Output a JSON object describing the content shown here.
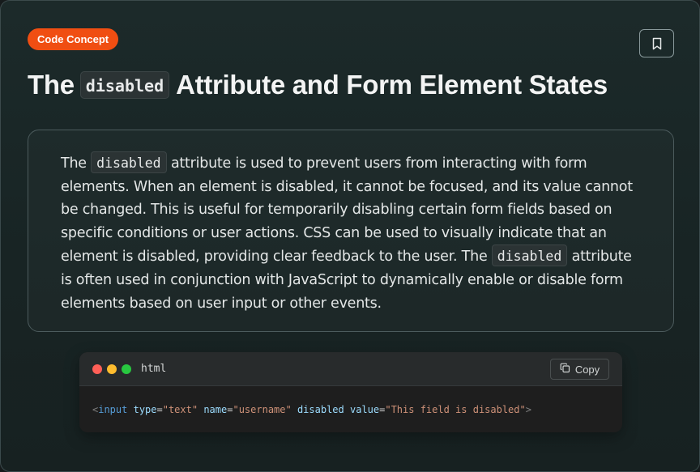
{
  "badge": {
    "label": "Code Concept"
  },
  "bookmark": {
    "icon": "bookmark-icon"
  },
  "title": {
    "before": "The",
    "code": "disabled",
    "after": "Attribute and Form Element States"
  },
  "description": {
    "part1": "The",
    "code1": "disabled",
    "part2": "attribute is used to prevent users from interacting with form elements. When an element is disabled, it cannot be focused, and its value cannot be changed. This is useful for temporarily disabling certain form fields based on specific conditions or user actions. CSS can be used to visually indicate that an element is disabled, providing clear feedback to the user. The",
    "code2": "disabled",
    "part3": "attribute is often used in conjunction with JavaScript to dynamically enable or disable form elements based on user input or other events."
  },
  "code_block": {
    "language": "html",
    "copy_label": "Copy",
    "copy_icon": "copy-icon",
    "tokens": {
      "open": "<",
      "tag": "input",
      "attr_type": "type",
      "eq1": "=",
      "val_type": "\"text\"",
      "attr_name": "name",
      "eq2": "=",
      "val_name": "\"username\"",
      "attr_disabled": "disabled",
      "attr_value": "value",
      "eq3": "=",
      "val_value": "\"This field is disabled\"",
      "close": ">"
    }
  },
  "colors": {
    "badge": "#f04e12",
    "window_red": "#ff5f57",
    "window_yellow": "#febc2e",
    "window_green": "#28c840"
  }
}
